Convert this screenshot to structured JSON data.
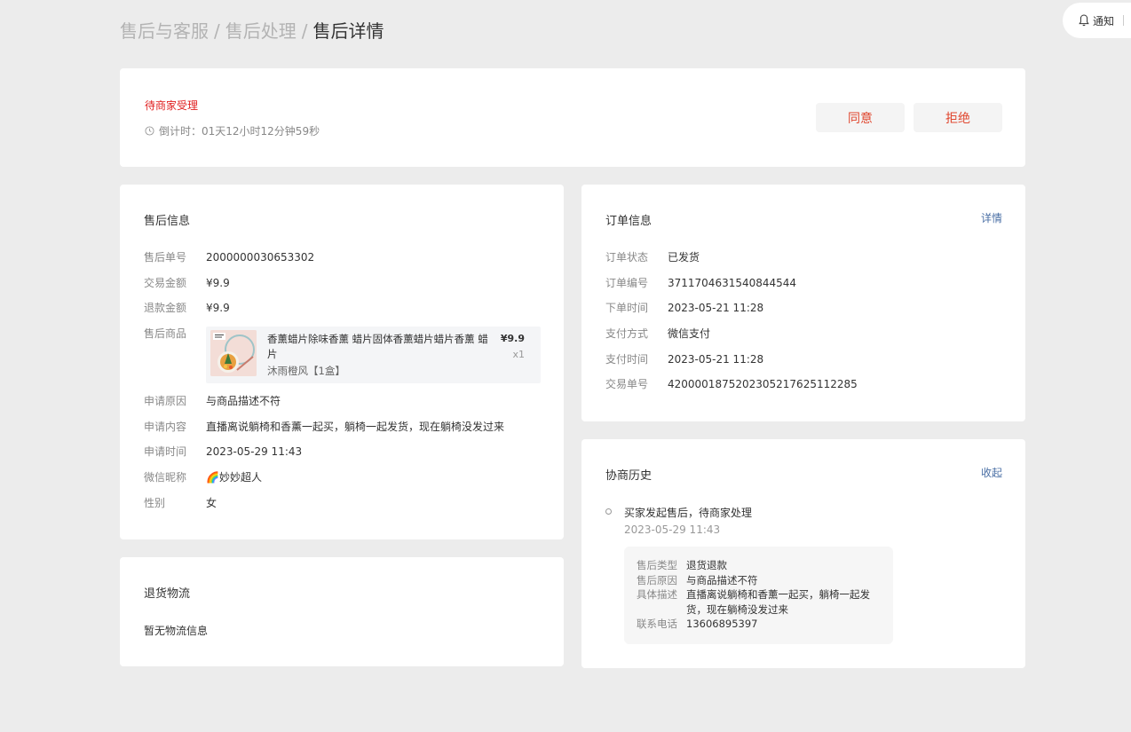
{
  "breadcrumb": {
    "level1": "售后与客服",
    "sep1": "/",
    "level2": "售后处理",
    "sep2": "/",
    "current": "售后详情"
  },
  "notify": {
    "label": "通知"
  },
  "status": {
    "text": "待商家受理",
    "countdown": "倒计时：01天12小时12分钟59秒",
    "agree_label": "同意",
    "reject_label": "拒绝",
    "accent_color": "#e02020"
  },
  "aftersale": {
    "title": "售后信息",
    "rows": [
      {
        "key": "售后单号",
        "value": "2000000030653302"
      },
      {
        "key": "交易金额",
        "value": "¥9.9"
      },
      {
        "key": "退款金额",
        "value": "¥9.9"
      },
      {
        "key": "售后商品",
        "value": ""
      },
      {
        "key": "申请原因",
        "value": "与商品描述不符"
      },
      {
        "key": "申请内容",
        "value": "直播离说躺椅和香薰一起买，躺椅一起发货，现在躺椅没发过来"
      },
      {
        "key": "申请时间",
        "value": "2023-05-29 11:43"
      },
      {
        "key": "微信昵称",
        "value": "🌈妙妙超人"
      },
      {
        "key": "性别",
        "value": "女"
      }
    ],
    "product": {
      "name": "香薰蜡片除味香薰 蜡片固体香薰蜡片蜡片香薰 蜡片",
      "spec": "沐雨橙风【1盒】",
      "price": "¥9.9",
      "qty": "x1"
    }
  },
  "order": {
    "title": "订单信息",
    "link": "详情",
    "rows": [
      {
        "key": "订单状态",
        "value": "已发货"
      },
      {
        "key": "订单编号",
        "value": "3711704631540844544"
      },
      {
        "key": "下单时间",
        "value": "2023-05-21 11:28"
      },
      {
        "key": "支付方式",
        "value": "微信支付"
      },
      {
        "key": "支付时间",
        "value": "2023-05-21 11:28"
      },
      {
        "key": "交易单号",
        "value": "4200001875202305217625112285"
      }
    ]
  },
  "logistics": {
    "title": "退货物流",
    "empty": "暂无物流信息"
  },
  "history": {
    "title": "协商历史",
    "link": "收起",
    "entry_title": "买家发起售后，待商家处理",
    "entry_time": "2023-05-29 11:43",
    "details": [
      {
        "key": "售后类型",
        "value": "退货退款"
      },
      {
        "key": "售后原因",
        "value": "与商品描述不符"
      },
      {
        "key": "具体描述",
        "value": "直播离说躺椅和香薰一起买，躺椅一起发货，现在躺椅没发过来"
      },
      {
        "key": "联系电话",
        "value": "13606895397"
      }
    ]
  }
}
